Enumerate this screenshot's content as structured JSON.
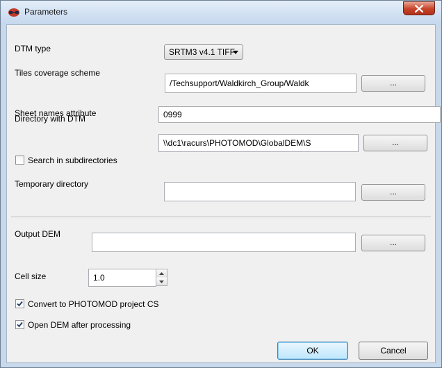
{
  "window": {
    "title": "Parameters",
    "close_icon": "close-icon"
  },
  "form": {
    "dtm_type": {
      "label": "DTM type",
      "selected": "SRTM3 v4.1 TIFF"
    },
    "tiles_coverage": {
      "label": "Tiles coverage scheme",
      "value": "/Techsupport/Waldkirch_Group/Waldk",
      "browse": "..."
    },
    "sheet_names": {
      "label": "Sheet names attribute",
      "value": "0999"
    },
    "directory_dtm": {
      "label": "Directory with DTM",
      "value": "\\\\dc1\\racurs\\PHOTOMOD\\GlobalDEM\\S",
      "browse": "..."
    },
    "search_subdirs": {
      "label": "Search in subdirectories",
      "checked": false
    },
    "temp_directory": {
      "label": "Temporary directory",
      "value": "",
      "browse": "..."
    },
    "output_dem": {
      "label": "Output DEM",
      "value": "",
      "browse": "..."
    },
    "cell_size": {
      "label": "Cell size",
      "value": "1.0"
    },
    "convert_cs": {
      "label": "Convert to PHOTOMOD project CS",
      "checked": true
    },
    "open_dem": {
      "label": "Open DEM after processing",
      "checked": true
    }
  },
  "buttons": {
    "ok": "OK",
    "cancel": "Cancel"
  }
}
